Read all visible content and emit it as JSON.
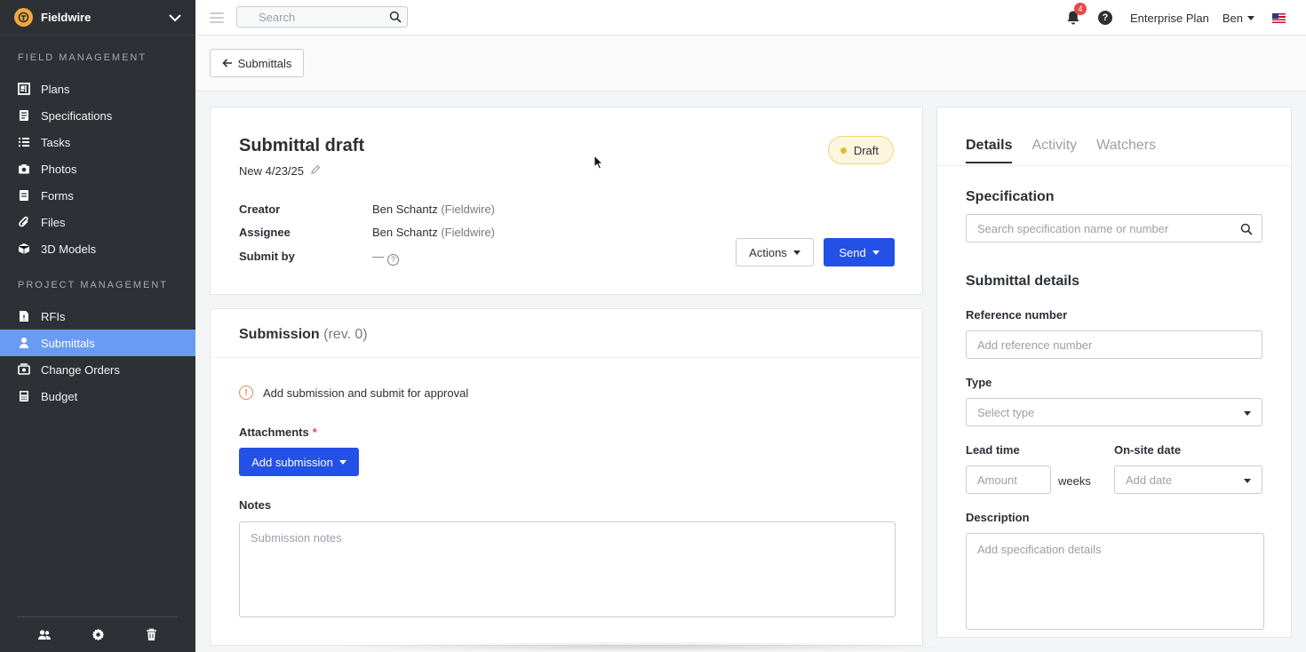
{
  "sidebar": {
    "brand": "Fieldwire",
    "section_field": "FIELD MANAGEMENT",
    "section_project": "PROJECT MANAGEMENT",
    "field_items": [
      {
        "label": "Plans",
        "icon": "plans-icon"
      },
      {
        "label": "Specifications",
        "icon": "specifications-icon"
      },
      {
        "label": "Tasks",
        "icon": "tasks-icon"
      },
      {
        "label": "Photos",
        "icon": "camera-icon"
      },
      {
        "label": "Forms",
        "icon": "forms-icon"
      },
      {
        "label": "Files",
        "icon": "paperclip-icon"
      },
      {
        "label": "3D Models",
        "icon": "cube-icon"
      }
    ],
    "project_items": [
      {
        "label": "RFIs",
        "icon": "rfi-icon"
      },
      {
        "label": "Submittals",
        "icon": "submittal-icon",
        "active": true
      },
      {
        "label": "Change Orders",
        "icon": "change-orders-icon"
      },
      {
        "label": "Budget",
        "icon": "budget-icon"
      }
    ],
    "active_color": "#6a9bf3"
  },
  "topbar": {
    "search_placeholder": "Search",
    "notification_count": "4",
    "help": "?",
    "plan": "Enterprise Plan",
    "user": "Ben"
  },
  "subheader": {
    "back_label": "Submittals"
  },
  "summary": {
    "title": "Submittal draft",
    "subtitle": "New 4/23/25",
    "status": "Draft",
    "creator_label": "Creator",
    "creator_name": "Ben Schantz",
    "creator_org": "(Fieldwire)",
    "assignee_label": "Assignee",
    "assignee_name": "Ben Schantz",
    "assignee_org": "(Fieldwire)",
    "submit_by_label": "Submit by",
    "submit_by_value": "—",
    "actions_label": "Actions",
    "send_label": "Send"
  },
  "submission": {
    "title": "Submission",
    "revision": "(rev. 0)",
    "warning": "Add submission and submit for approval",
    "attachments_label": "Attachments",
    "required_mark": "*",
    "add_label": "Add submission",
    "notes_label": "Notes",
    "notes_placeholder": "Submission notes"
  },
  "details": {
    "tabs": [
      {
        "label": "Details",
        "active": true
      },
      {
        "label": "Activity",
        "active": false
      },
      {
        "label": "Watchers",
        "active": false
      }
    ],
    "spec_title": "Specification",
    "spec_placeholder": "Search specification name or number",
    "details_title": "Submittal details",
    "ref_label": "Reference number",
    "ref_placeholder": "Add reference number",
    "type_label": "Type",
    "type_placeholder": "Select type",
    "lead_label": "Lead time",
    "lead_placeholder": "Amount",
    "lead_unit": "weeks",
    "onsite_label": "On-site date",
    "onsite_placeholder": "Add date",
    "desc_label": "Description",
    "desc_placeholder": "Add specification details"
  },
  "colors": {
    "primary": "#2350e6",
    "draft_bg": "#fdf6df",
    "draft_dot": "#e8b83a",
    "badge": "#e5484d"
  }
}
